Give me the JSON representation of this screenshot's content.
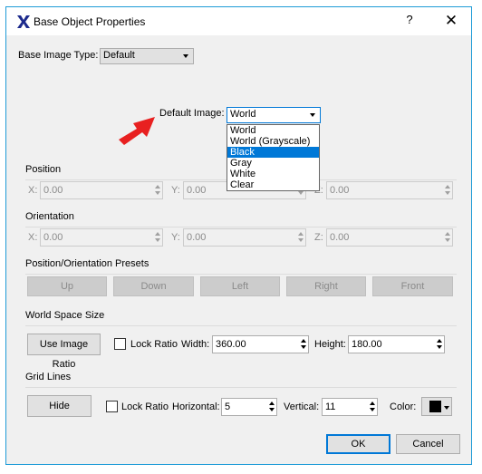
{
  "window": {
    "title": "Base Object Properties",
    "help_icon": "?",
    "close_icon": "✕"
  },
  "base_image_type": {
    "label": "Base Image Type:",
    "value": "Default"
  },
  "default_image": {
    "label": "Default Image:",
    "value": "World",
    "options": [
      "World",
      "World (Grayscale)",
      "Black",
      "Gray",
      "White",
      "Clear"
    ],
    "highlighted": "Black"
  },
  "arrow_color": "#e82020",
  "position": {
    "title": "Position",
    "x_label": "X:",
    "x": "0.00",
    "y_label": "Y:",
    "y": "0.00",
    "z_label": "Z:",
    "z": "0.00"
  },
  "orientation": {
    "title": "Orientation",
    "x_label": "X:",
    "x": "0.00",
    "y_label": "Y:",
    "y": "0.00",
    "z_label": "Z:",
    "z": "0.00"
  },
  "presets": {
    "title": "Position/Orientation Presets",
    "buttons": [
      "Up",
      "Down",
      "Left",
      "Right",
      "Front"
    ]
  },
  "world_space": {
    "title": "World Space Size",
    "use_image_ratio": "Use Image Ratio",
    "lock_ratio": "Lock Ratio",
    "width_label": "Width:",
    "width": "360.00",
    "height_label": "Height:",
    "height": "180.00"
  },
  "grid": {
    "title": "Grid Lines",
    "hide": "Hide",
    "lock_ratio": "Lock Ratio",
    "horizontal_label": "Horizontal:",
    "horizontal": "5",
    "vertical_label": "Vertical:",
    "vertical": "11",
    "color_label": "Color:",
    "color": "#000000"
  },
  "footer": {
    "ok": "OK",
    "cancel": "Cancel"
  }
}
